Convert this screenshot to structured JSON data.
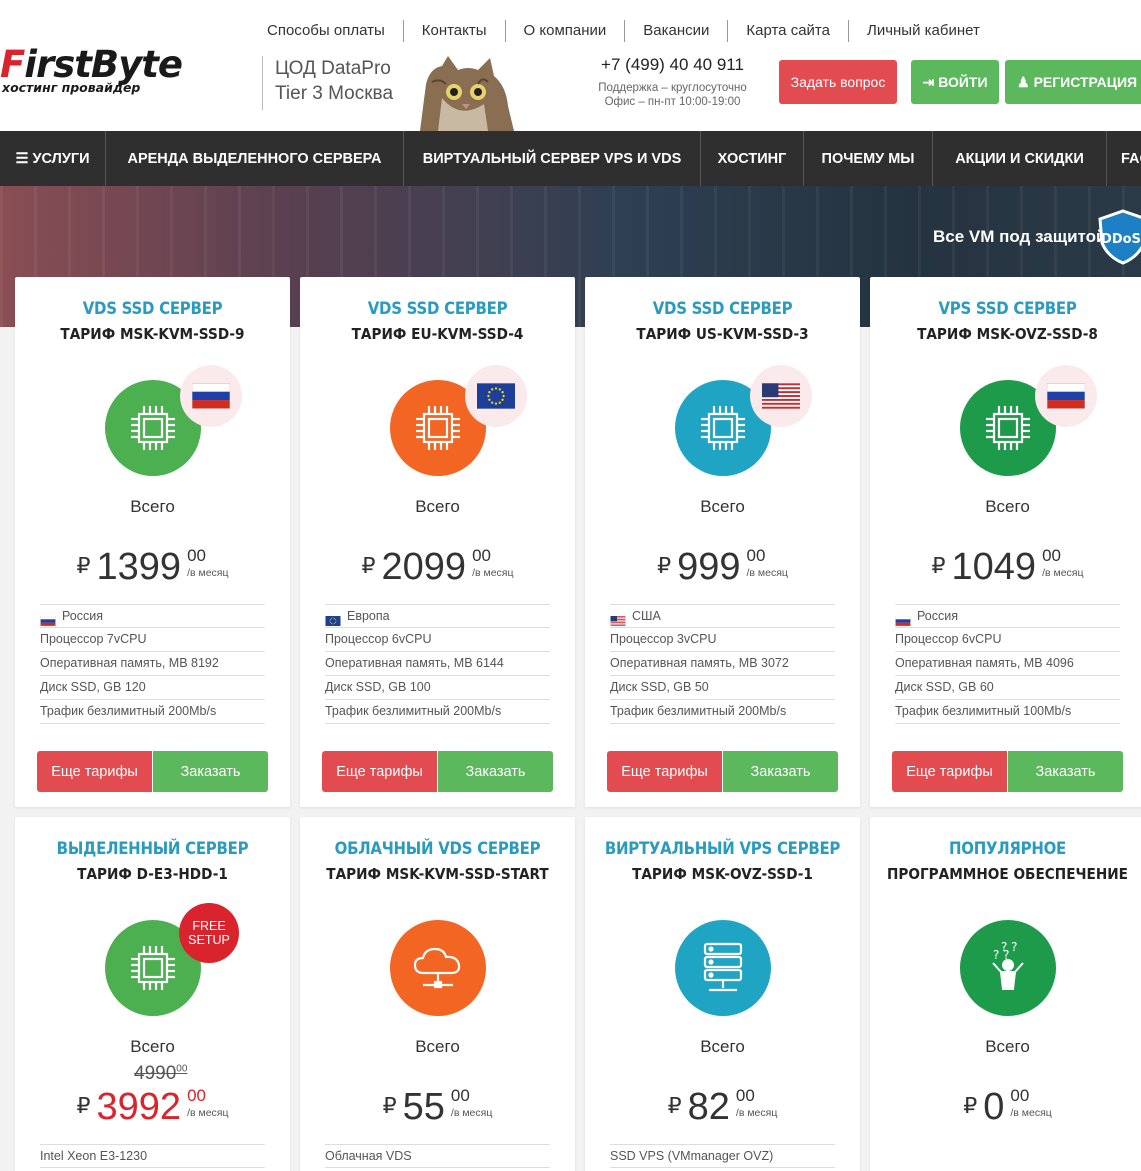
{
  "topnav": [
    "Способы оплаты",
    "Контакты",
    "О компании",
    "Вакансии",
    "Карта сайта",
    "Личный кабинет"
  ],
  "logo": {
    "part1": "F",
    "part2": "irstByte",
    "sub": "хостинг провайдер"
  },
  "datacenter": {
    "line1": "ЦОД DataPro",
    "line2": "Tier 3 Москва"
  },
  "contacts": {
    "phone": "+7 (499) 40 40 911",
    "support": "Поддержка – круглосуточно",
    "office": "Офис – пн-пт 10:00-19:00"
  },
  "buttons": {
    "ask": "Задать вопрос",
    "login": "ВОЙТИ",
    "register": "РЕГИСТРАЦИЯ"
  },
  "mainnav": [
    "☰ УСЛУГИ",
    "АРЕНДА ВЫДЕЛЕННОГО СЕРВЕРА",
    "ВИРТУАЛЬНЫЙ СЕРВЕР VPS И VDS",
    "ХОСТИНГ",
    "ПОЧЕМУ МЫ",
    "АКЦИИ И СКИДКИ",
    "FAQ"
  ],
  "banner": {
    "text": "Все VM под защитой",
    "badge": "DDoS"
  },
  "labels": {
    "vsego": "Всего",
    "currency": "₽",
    "per_month": "/в месяц",
    "more": "Еще тарифы",
    "order": "Заказать",
    "free1": "FREE",
    "free2": "SETUP"
  },
  "cards_top": [
    {
      "cat": "VDS SSD СЕРВЕР",
      "tariff": "ТАРИФ MSK-KVM-SSD-9",
      "color": "#4caf50",
      "flag": "ru",
      "price": "1399",
      "kop": "00",
      "specs": [
        "Россия",
        "Процессор 7vCPU",
        "Оперативная память, MB 8192",
        "Диск SSD, GB 120",
        "Трафик безлимитный 200Mb/s"
      ]
    },
    {
      "cat": "VDS SSD СЕРВЕР",
      "tariff": "ТАРИФ EU-KVM-SSD-4",
      "color": "#f26522",
      "flag": "eu",
      "price": "2099",
      "kop": "00",
      "specs": [
        "Европа",
        "Процессор 6vCPU",
        "Оперативная память, MB 6144",
        "Диск SSD, GB 100",
        "Трафик безлимитный 200Mb/s"
      ]
    },
    {
      "cat": "VDS SSD СЕРВЕР",
      "tariff": "ТАРИФ US-KVM-SSD-3",
      "color": "#1fa5c3",
      "flag": "us",
      "price": "999",
      "kop": "00",
      "specs": [
        "США",
        "Процессор 3vCPU",
        "Оперативная память, MB 3072",
        "Диск SSD, GB 50",
        "Трафик безлимитный 200Mb/s"
      ]
    },
    {
      "cat": "VPS SSD СЕРВЕР",
      "tariff": "ТАРИФ MSK-OVZ-SSD-8",
      "color": "#1e9a4b",
      "flag": "ru",
      "price": "1049",
      "kop": "00",
      "specs": [
        "Россия",
        "Процессор 6vCPU",
        "Оперативная память, MB 4096",
        "Диск SSD, GB 60",
        "Трафик безлимитный 100Mb/s"
      ]
    }
  ],
  "cards_bottom": [
    {
      "cat": "ВЫДЕЛЕННЫЙ СЕРВЕР",
      "tariff": "ТАРИФ D-E3-HDD-1",
      "color": "#4caf50",
      "icon": "chip",
      "price": "3992",
      "kop": "00",
      "old_price": "4990",
      "old_kop": "00",
      "spec": "Intel Xeon E3-1230"
    },
    {
      "cat": "ОБЛАЧНЫЙ VDS СЕРВЕР",
      "tariff": "ТАРИФ MSK-KVM-SSD-START",
      "color": "#f26522",
      "icon": "cloud",
      "price": "55",
      "kop": "00",
      "spec": "Облачная VDS"
    },
    {
      "cat": "ВИРТУАЛЬНЫЙ VPS СЕРВЕР",
      "tariff": "ТАРИФ MSK-OVZ-SSD-1",
      "color": "#1fa5c3",
      "icon": "server",
      "price": "82",
      "kop": "00",
      "spec": "SSD VPS (VMmanager OVZ)"
    },
    {
      "cat": "ПОПУЛЯРНОЕ",
      "tariff": "ПРОГРАММНОЕ ОБЕСПЕЧЕНИЕ",
      "color": "#1e9a4b",
      "icon": "person",
      "price": "0",
      "kop": "00",
      "spec": ""
    }
  ]
}
